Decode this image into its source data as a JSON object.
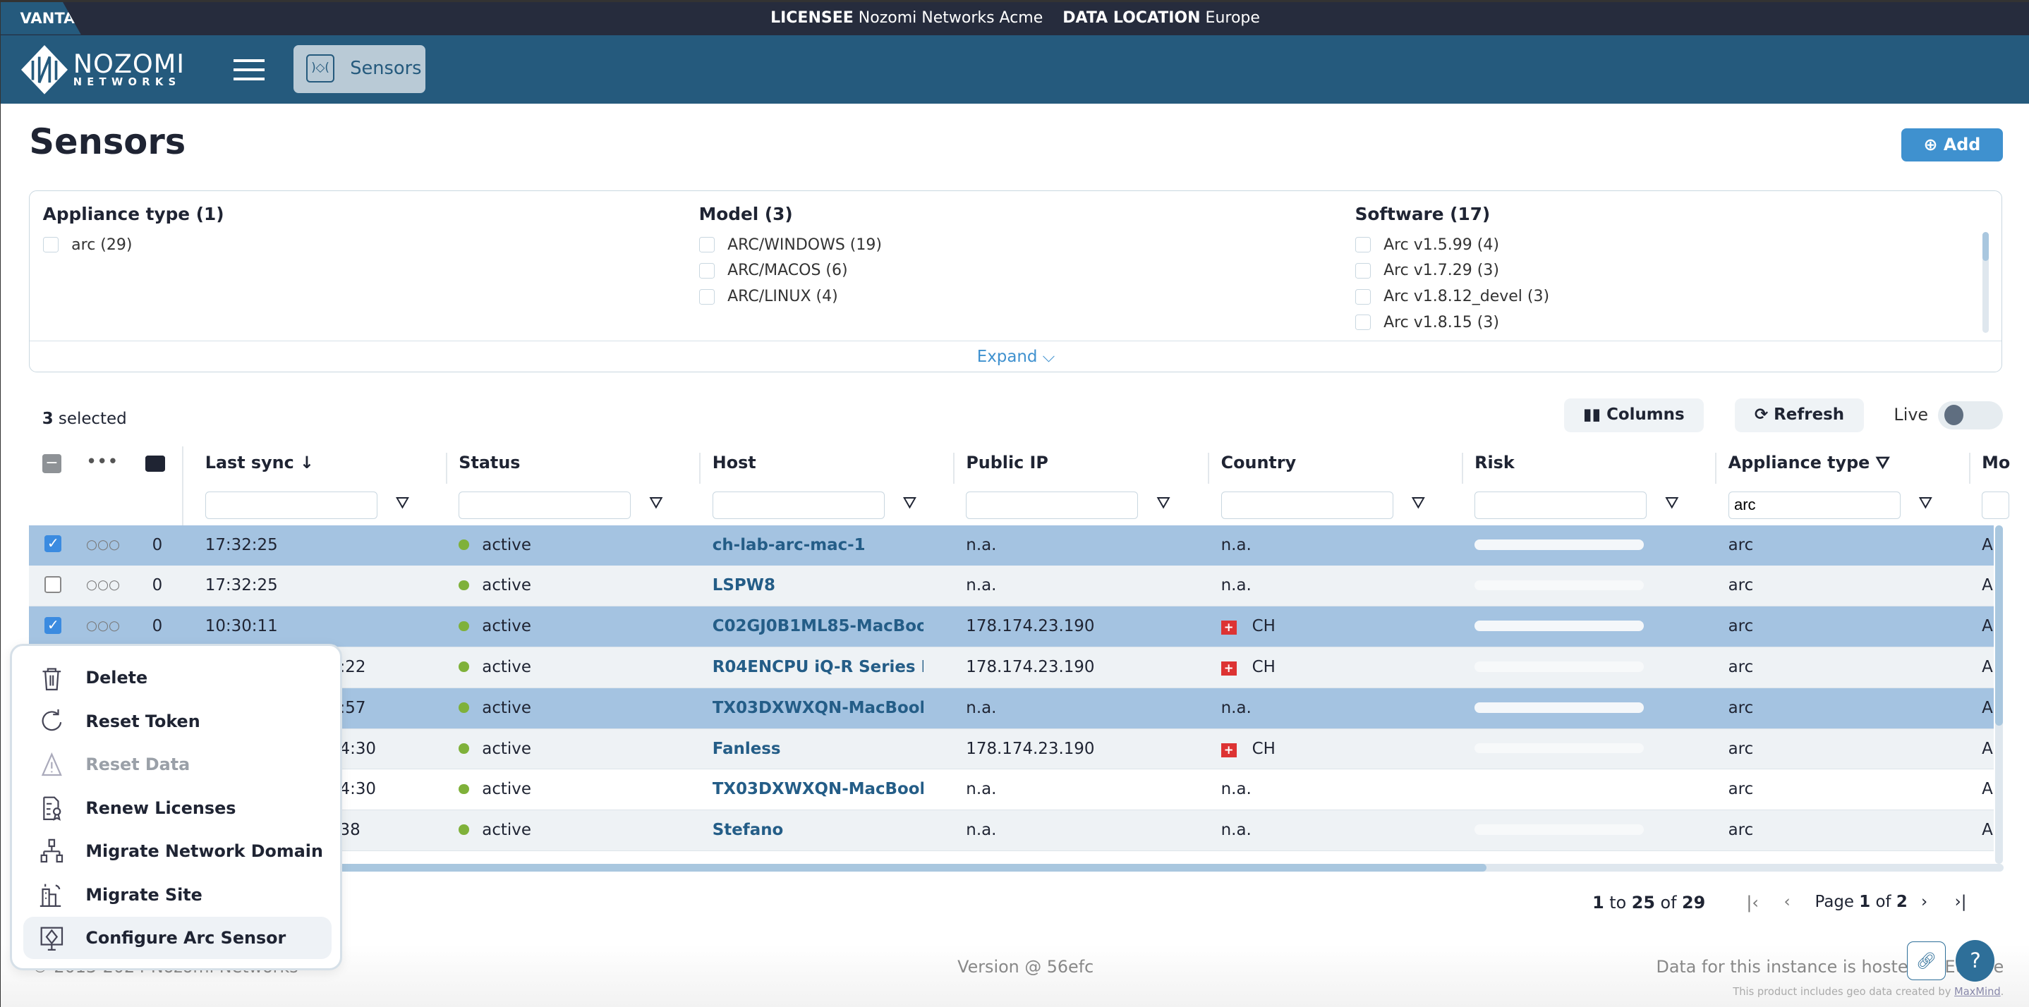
{
  "topbar": {
    "brand": "VANTAGE",
    "licensee_label": "LICENSEE",
    "licensee": "Nozomi Networks Acme",
    "location_label": "DATA LOCATION",
    "location": "Europe"
  },
  "nav": {
    "logo_line1": "NOZOMI",
    "logo_line2": "NETWORKS",
    "active_label": "Sensors"
  },
  "page": {
    "title": "Sensors",
    "add_label": "Add"
  },
  "filters": {
    "groups": [
      {
        "title": "Appliance type (1)",
        "items": [
          "arc (29)"
        ]
      },
      {
        "title": "Model (3)",
        "items": [
          "ARC/WINDOWS (19)",
          "ARC/MACOS (6)",
          "ARC/LINUX (4)"
        ]
      },
      {
        "title": "Software (17)",
        "items": [
          "Arc v1.5.99 (4)",
          "Arc v1.7.29 (3)",
          "Arc v1.8.12_devel (3)",
          "Arc v1.8.15 (3)"
        ]
      }
    ],
    "expand_label": "Expand"
  },
  "toolbar": {
    "selected_count": "3",
    "selected_label": "selected",
    "columns_label": "Columns",
    "refresh_label": "Refresh",
    "live_label": "Live",
    "live_on": false
  },
  "table": {
    "columns": [
      "Last sync",
      "Status",
      "Host",
      "Public IP",
      "Country",
      "Risk",
      "Appliance type",
      "Mo"
    ],
    "appliance_filter": "arc",
    "rows": [
      {
        "selected": true,
        "comments": "0",
        "last_sync": "17:32:25",
        "status": "active",
        "host": "ch-lab-arc-mac-1",
        "ip": "n.a.",
        "country": "n.a.",
        "flag": false,
        "type": "arc",
        "model": "A"
      },
      {
        "selected": false,
        "comments": "0",
        "last_sync": "17:32:25",
        "status": "active",
        "host": "LSPW8",
        "ip": "n.a.",
        "country": "n.a.",
        "flag": false,
        "type": "arc",
        "model": "A"
      },
      {
        "selected": true,
        "comments": "0",
        "last_sync": "10:30:11",
        "status": "active",
        "host": "C02GJ0B1ML85-MacBoo",
        "ip": "178.174.23.190",
        "country": "CH",
        "flag": true,
        "type": "arc",
        "model": "A"
      },
      {
        "selected": false,
        "last_sync": ":22",
        "status": "active",
        "host": "R04ENCPU iQ-R Series F",
        "ip": "178.174.23.190",
        "country": "CH",
        "flag": true,
        "type": "arc",
        "model": "A"
      },
      {
        "selected": true,
        "last_sync": ":57",
        "status": "active",
        "host": "TX03DXWXQN-MacBook",
        "ip": "n.a.",
        "country": "n.a.",
        "flag": false,
        "type": "arc",
        "model": "A"
      },
      {
        "selected": false,
        "last_sync": "4:30",
        "status": "active",
        "host": "Fanless",
        "ip": "178.174.23.190",
        "country": "CH",
        "flag": true,
        "type": "arc",
        "model": "A"
      },
      {
        "selected": false,
        "last_sync": "4:30",
        "status": "active",
        "host": "TX03DXWXQN-MacBook",
        "ip": "n.a.",
        "country": "n.a.",
        "flag": false,
        "type": "arc",
        "model": "A"
      },
      {
        "selected": false,
        "last_sync": "38",
        "status": "active",
        "host": "Stefano",
        "ip": "n.a.",
        "country": "n.a.",
        "flag": false,
        "type": "arc",
        "model": "A"
      }
    ]
  },
  "pagination": {
    "from": "1",
    "to_label": "to",
    "to": "25",
    "of_label": "of",
    "total": "29",
    "page_label": "Page",
    "page": "1",
    "pages": "2"
  },
  "context_menu": {
    "items": [
      {
        "label": "Delete",
        "icon": "trash-icon"
      },
      {
        "label": "Reset Token",
        "icon": "refresh-icon"
      },
      {
        "label": "Reset Data",
        "icon": "warning-icon",
        "disabled": true
      },
      {
        "label": "Renew Licenses",
        "icon": "certificate-icon"
      },
      {
        "label": "Migrate Network Domain",
        "icon": "network-icon"
      },
      {
        "label": "Migrate Site",
        "icon": "building-icon"
      },
      {
        "label": "Configure Arc Sensor",
        "icon": "sensor-config-icon",
        "highlighted": true
      }
    ]
  },
  "footer": {
    "copyright": "© 2013-2024 Nozomi Networks",
    "version": "Version @ 56efc",
    "hosted": "Data for this instance is hosted in Europe",
    "geo_prefix": "This product includes geo data created by",
    "geo_link": "MaxMind"
  },
  "colors": {
    "navbar": "#255a7d",
    "topbar": "#262c3d",
    "accent": "#3f91cf",
    "selected_row": "#a4c3e1",
    "status_active": "#7fb13a"
  }
}
